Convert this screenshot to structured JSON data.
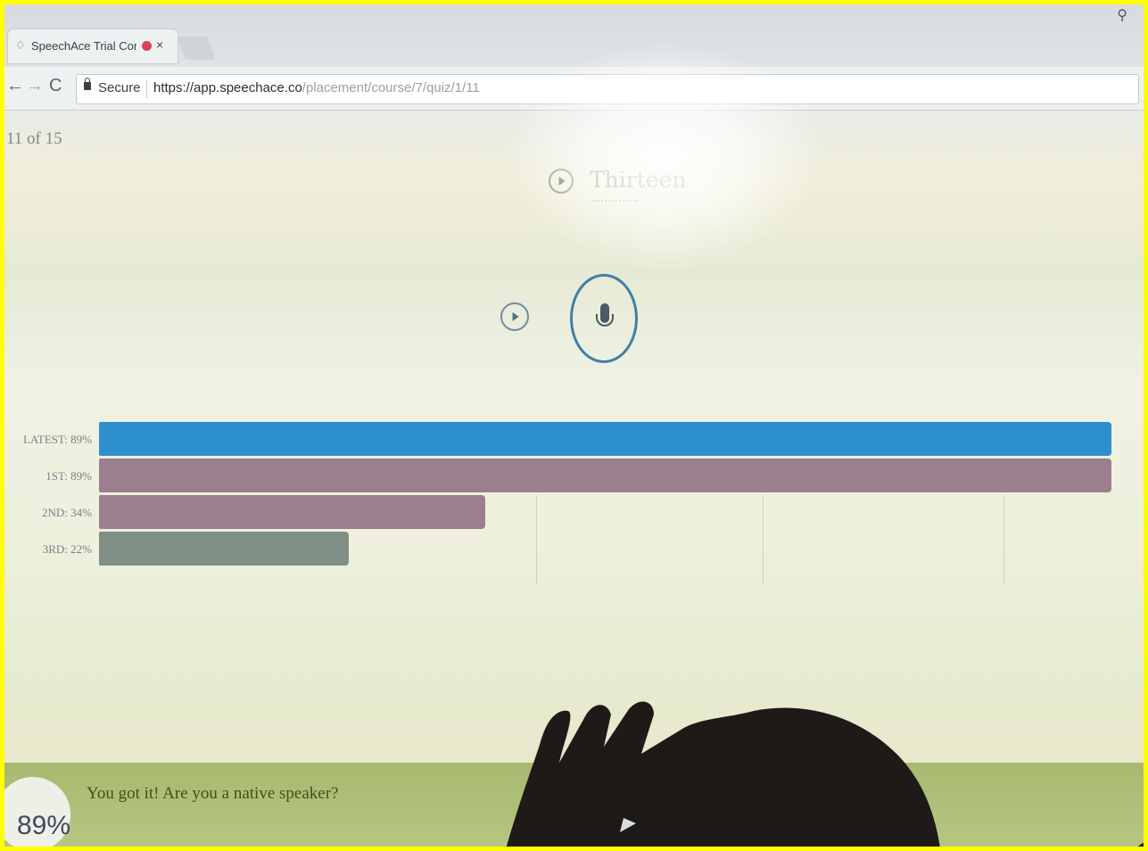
{
  "browser": {
    "tab_title": "SpeechAce Trial Cont",
    "tab_close": "×",
    "secure_label": "Secure",
    "url_host": "https://app.speechace.co",
    "url_path": "/placement/course/7/quiz/1/11",
    "back_icon": "←",
    "forward_icon": "→",
    "reload_icon": "C",
    "profile_icon": "user-icon"
  },
  "quiz": {
    "progress": "11 of 15",
    "word": "Thirteen"
  },
  "scores": {
    "labels": [
      "LATEST: 89%",
      "1ST: 89%",
      "2ND: 34%",
      "3RD: 22%"
    ],
    "values": [
      89,
      89,
      34,
      22
    ],
    "colors": [
      "#2e8fcf",
      "#9c7f8e",
      "#9c7f8e",
      "#7f8f86"
    ]
  },
  "feedback": {
    "message": "You got it! Are you a native speaker?",
    "score": "89%"
  }
}
